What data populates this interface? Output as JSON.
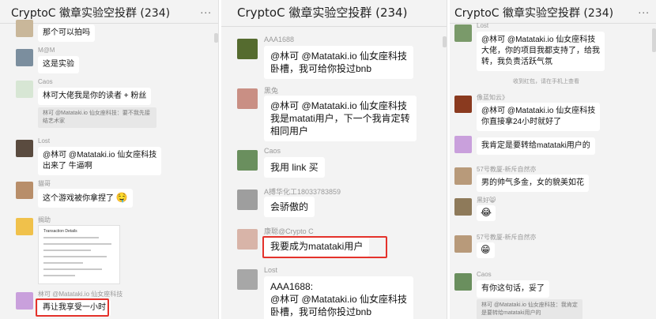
{
  "header": {
    "title": "CryptoC 徽章实验空投群 (234)",
    "more": "..."
  },
  "panel1": {
    "messages": [
      {
        "nick": "",
        "text": "那个可以拍吗"
      },
      {
        "nick": "M@M",
        "text": "这是实验"
      },
      {
        "nick": "Caos",
        "text": "林可大佬我是你的读者 + 粉丝",
        "quote": "林可 @Matataki.io 仙女座科技：要不我先接结艺术家"
      },
      {
        "nick": "Lost",
        "text1": "@林可 @Matataki.io 仙女座科技",
        "text2": "出来了 牛逼啊"
      },
      {
        "nick": "貓哥",
        "text": "这个游戏被你拿捏了",
        "emoji": "🤤"
      },
      {
        "nick": "搁助",
        "screenshot_title": "Transaction Details"
      },
      {
        "nick": "林可 @Matataki.io 仙女座科技",
        "text": "再让我享受一小时"
      }
    ]
  },
  "panel2": {
    "messages": [
      {
        "nick": "AAA1688",
        "text1": "@林可 @Matataki.io 仙女座科技",
        "text2": "卧槽，我可给你投过bnb"
      },
      {
        "nick": "黑兔",
        "text1": "@林可 @Matataki.io 仙女座科技",
        "text2": "我是matati用户，下一个我肯定转",
        "text3": "相同用户"
      },
      {
        "nick": "Caos",
        "text": "我用 link 买"
      },
      {
        "nick": "A搏华化工18033783859",
        "text": "会骄傲的"
      },
      {
        "nick": "康聪@Crypto C",
        "text": "我要成为matataki用户"
      },
      {
        "nick": "Lost",
        "text0": "AAA1688:",
        "text1": "@林可 @Matataki.io 仙女座科技",
        "text2": "卧槽，我可给你投过bnb"
      }
    ]
  },
  "panel3": {
    "messages": [
      {
        "nick": "Lost",
        "text1": "@林可 @Matataki.io 仙女座科技",
        "text2": "大佬，你的项目我都支持了，给我",
        "text3": "转，我负责活跃气氛"
      },
      {
        "sys": "收到红包，请在手机上查看"
      },
      {
        "nick": "像蓝知云》",
        "text1": "@林可 @Matataki.io 仙女座科技",
        "text2": "你直接拿24小时就好了"
      },
      {
        "nick": "",
        "text": "我肯定是要转给matataki用户的"
      },
      {
        "nick": "57号教厦-新斥自然亦",
        "text": "男的帅气多金，女的貌美如花"
      },
      {
        "nick": "黑好😸",
        "emoji": "😂"
      },
      {
        "nick": "57号教厦-新斥自然亦",
        "emoji": "😁"
      },
      {
        "nick": "Caos",
        "text": "有你这句话，妥了",
        "quote1": "林可 @Matataki.io 仙女座科技：我肯定",
        "quote2": "是要转给matataki用户的"
      }
    ]
  },
  "colors": {
    "panel_bg": "#f3f3f3",
    "bubble": "#ffffff",
    "highlight": "#e4322b"
  }
}
